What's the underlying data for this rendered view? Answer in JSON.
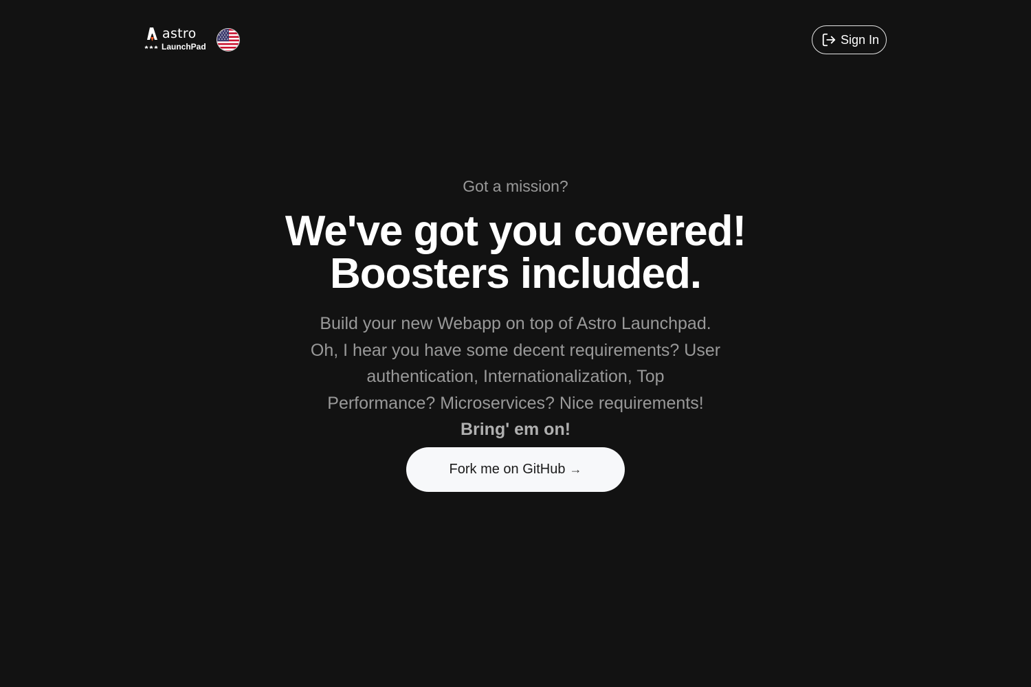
{
  "header": {
    "logo": {
      "wordmark": "astro",
      "subtitle": "LaunchPad",
      "dots": "***"
    },
    "language_flag": "us-flag-icon",
    "signin_label": "Sign In",
    "signin_icon": "sign-in-icon"
  },
  "hero": {
    "eyebrow": "Got a mission?",
    "headline_line1": "We've got you covered!",
    "headline_line2": "Boosters included.",
    "description_lines": [
      "Build your new Webapp on top of Astro Launchpad.",
      "Oh, I hear you have some decent requirements? User",
      "authentication, Internationalization, Top",
      "Performance? Microservices? Nice requirements!"
    ],
    "description_emphasis": "Bring' em on!",
    "cta_label": "Fork me on GitHub",
    "cta_arrow": "→"
  },
  "colors": {
    "background": "#121212",
    "text_primary": "#ffffff",
    "text_muted": "#999999",
    "cta_background": "#f7f8fa",
    "logo_accent": "#f15a24"
  }
}
